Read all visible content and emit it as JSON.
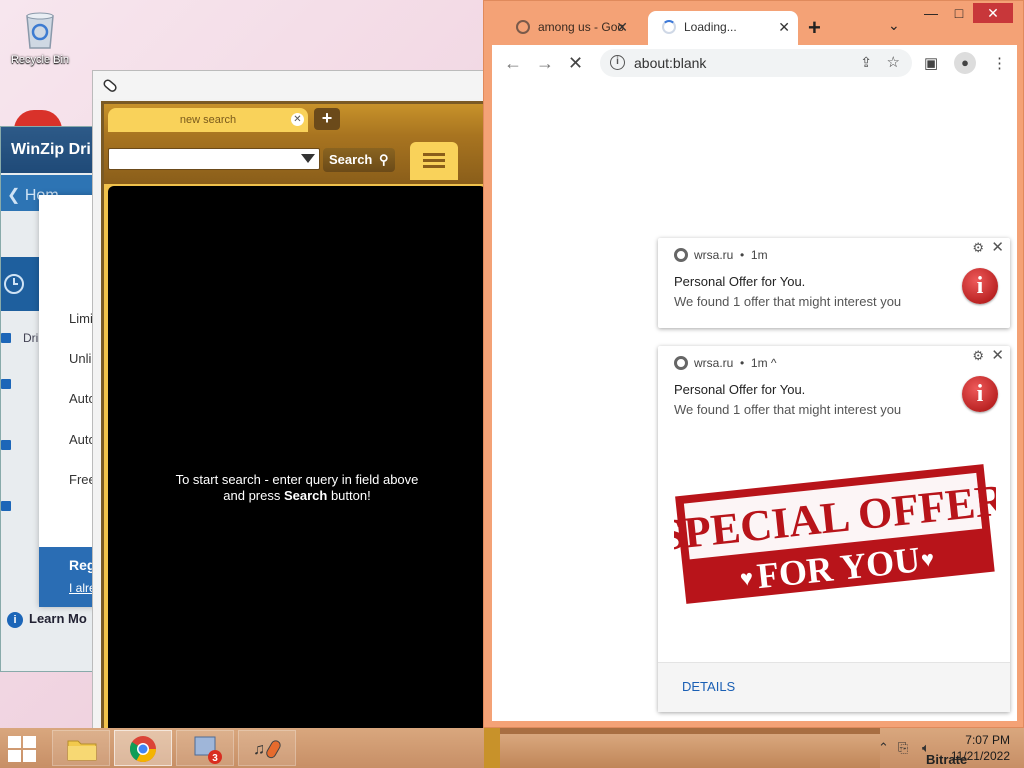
{
  "desktop": {
    "recycle_bin_label": "Recycle Bin"
  },
  "winzip": {
    "title": "WinZip Dri",
    "home_label": "Hom",
    "list_header": "Dri",
    "rows": [
      "Limi",
      "Unli",
      "Auto",
      "Auto",
      "Free"
    ],
    "register_label": "Reg",
    "already_label": "I alre",
    "learn_more": "Learn Mo"
  },
  "search_app": {
    "tab_label": "new search",
    "search_button": "Search",
    "hint_line1": "To start search - enter query in field above",
    "hint_line2_prefix": "and press ",
    "hint_line2_bold": "Search",
    "hint_line2_suffix": " button!"
  },
  "chrome": {
    "tabs": [
      {
        "label": "among us - Goo",
        "state": "inactive",
        "icon": "globe-icon"
      },
      {
        "label": "Loading...",
        "state": "active",
        "icon": "loading-spinner"
      }
    ],
    "address": "about:blank",
    "accent_color": "#f4a276"
  },
  "notifications": [
    {
      "source": "wrsa.ru",
      "time": "1m",
      "title": "Personal Offer for You.",
      "message": "We found 1 offer that might interest you",
      "expanded": false
    },
    {
      "source": "wrsa.ru",
      "time": "1m",
      "title": "Personal Offer for You.",
      "message": "We found 1 offer that might interest you",
      "expanded": true,
      "stamp_line1": "SPECIAL OFFER",
      "stamp_line2": "FOR YOU",
      "action": "DETAILS"
    }
  ],
  "taskbar": {
    "time": "7:07 PM",
    "date": "11/21/2022",
    "badge_count": "3",
    "bitrate_label": "Bitrate"
  }
}
